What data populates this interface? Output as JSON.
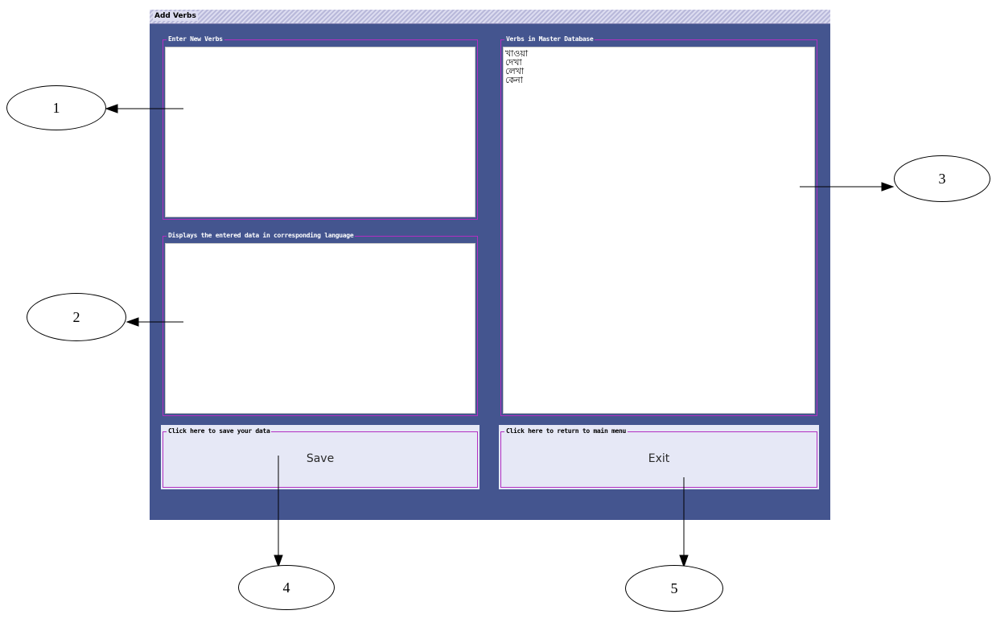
{
  "window": {
    "title": "Add Verbs"
  },
  "enter_panel": {
    "title": "Enter New Verbs",
    "value": ""
  },
  "display_panel": {
    "title": "Displays the entered data in corresponding language",
    "value": ""
  },
  "master_panel": {
    "title": "Verbs in Master Database",
    "verbs": [
      "খাওয়া",
      "দেখা",
      "লেখা",
      "কেনা"
    ]
  },
  "save_panel": {
    "title": "Click here to save your data",
    "button_label": "Save"
  },
  "exit_panel": {
    "title": "Click here to return to main menu",
    "button_label": "Exit"
  },
  "annotations": [
    "1",
    "2",
    "3",
    "4",
    "5"
  ],
  "colors": {
    "window_bg": "#44558f",
    "frame_border": "#b22fc2",
    "panel_bg": "#e6e8f6",
    "text_area_bg": "#ffffff"
  }
}
